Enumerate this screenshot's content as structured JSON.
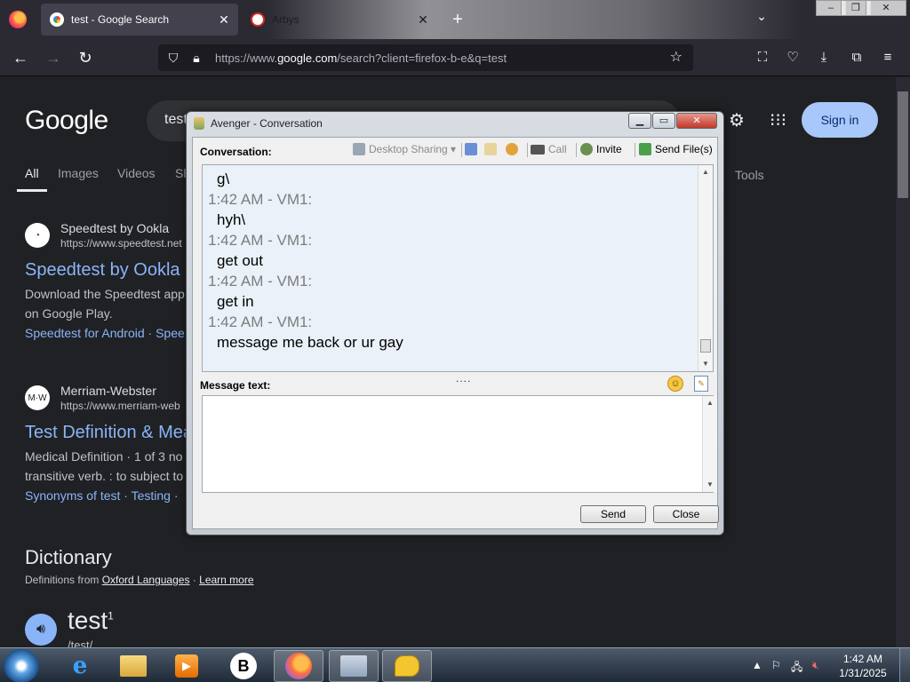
{
  "browser": {
    "tabs": [
      {
        "label": "test - Google Search",
        "favicon": "google-favicon"
      },
      {
        "label": "Arbys",
        "favicon": "arbys-favicon"
      }
    ],
    "newtab_label": "+",
    "url_prefix": "https://www.",
    "url_domain": "google.com",
    "url_rest": "/search?client=firefox-b-e&q=test"
  },
  "google": {
    "logo": "Google",
    "query": "test",
    "signin": "Sign in",
    "tabs": [
      "All",
      "Images",
      "Videos",
      "Sh"
    ],
    "tools": "Tools",
    "results": [
      {
        "site": "Speedtest by Ookla",
        "url": "https://www.speedtest.net",
        "title": "Speedtest by Ookla",
        "snippet1": "Download the Speedtest app",
        "snippet2": "on Google Play.",
        "links": "Speedtest for Android · Spee"
      },
      {
        "site": "Merriam-Webster",
        "url": "https://www.merriam-web",
        "title": "Test Definition & Mea",
        "snippet1": "Medical Definition · 1 of 3 no",
        "snippet2": "transitive verb. : to subject to",
        "links": "Synonyms of test · Testing ·",
        "favicon_text": "M·W"
      }
    ],
    "dictionary": {
      "heading": "Dictionary",
      "source_prefix": "Definitions from",
      "source": "Oxford Languages",
      "sep": "·",
      "learn_more": "Learn more",
      "word": "test",
      "sup": "1",
      "phonetic": "/test/"
    }
  },
  "avenger": {
    "title": "Avenger - Conversation",
    "conversation_label": "Conversation:",
    "toolbar": {
      "desktop_sharing": "Desktop Sharing",
      "call": "Call",
      "invite": "Invite",
      "send_files": "Send File(s)"
    },
    "messages": [
      {
        "text": "g\\"
      },
      {
        "header": "1:42 AM - VM1:",
        "text": "hyh\\"
      },
      {
        "header": "1:42 AM - VM1:",
        "text": "get out"
      },
      {
        "header": "1:42 AM - VM1:",
        "text": "get in"
      },
      {
        "header": "1:42 AM - VM1:",
        "text": "message me back or ur gay"
      }
    ],
    "message_label": "Message text:",
    "message_value": "",
    "send": "Send",
    "close": "Close",
    "grip": "....",
    "emoji_glyph": "☺",
    "colors": {
      "conversation_bg": "#eaf1f9",
      "header_text": "#7d7d7d"
    }
  },
  "taskbar": {
    "clock_time": "1:42 AM",
    "clock_date": "1/31/2025",
    "brave_letter": "B"
  }
}
